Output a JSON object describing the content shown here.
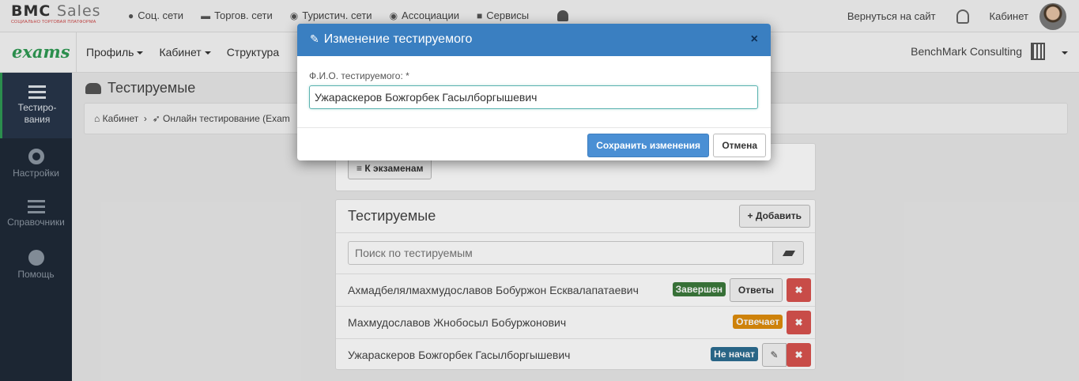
{
  "topbar": {
    "logo_text_1": "BMC",
    "logo_text_2": "Sales",
    "logo_sub": "СОЦИАЛЬНО ТОРГОВАЯ ПЛАТФОРМА",
    "links": [
      {
        "label": "Соц. сети",
        "icon": "comment-icon"
      },
      {
        "label": "Торгов. сети",
        "icon": "cart-icon"
      },
      {
        "label": "Туристич. сети",
        "icon": "globe-icon"
      },
      {
        "label": "Ассоциации",
        "icon": "globe-icon"
      },
      {
        "label": "Сервисы",
        "icon": "briefcase-icon"
      }
    ],
    "back_to_site": "Вернуться на сайт",
    "cabinet": "Кабинет"
  },
  "navbar": {
    "brand": "exams",
    "items": [
      "Профиль",
      "Кабинет",
      "Структура"
    ],
    "company": "BenchMark Consulting"
  },
  "sidebar": {
    "items": [
      {
        "label": "Тестиро-вания",
        "icon": "list-icon"
      },
      {
        "label": "Настройки",
        "icon": "gear-icon"
      },
      {
        "label": "Справочники",
        "icon": "list-icon"
      },
      {
        "label": "Помощь",
        "icon": "question-icon"
      }
    ]
  },
  "page": {
    "title": "Тестируемые",
    "breadcrumb_1": "Кабинет",
    "breadcrumb_2": "Онлайн тестирование (Exam"
  },
  "exams_button": "К экзаменам",
  "testees": {
    "title": "Тестируемые",
    "add_label": "Добавить",
    "search_placeholder": "Поиск по тестируемым",
    "rows": [
      {
        "name": "Ахмадбелялмахмудославов Бобуржон Есквалапатаевич",
        "status": "Завершен",
        "status_color": "#3c7a3c",
        "action": "Ответы"
      },
      {
        "name": "Махмудославов Жнобосыл Бобуржонович",
        "status": "Отвечает",
        "status_color": "#e08e0b"
      },
      {
        "name": "Ужараскеров Божгорбек Гасылборгышевич",
        "status": "Не начат",
        "status_color": "#2d6e92"
      }
    ],
    "delete_glyph": "✖"
  },
  "modal": {
    "title": "Изменение тестируемого",
    "close_glyph": "×",
    "field_label": "Ф.И.О. тестируемого: *",
    "field_value": "Ужараскеров Божгорбек Гасылборгышевич",
    "save_label": "Сохранить изменения",
    "cancel_label": "Отмена"
  }
}
